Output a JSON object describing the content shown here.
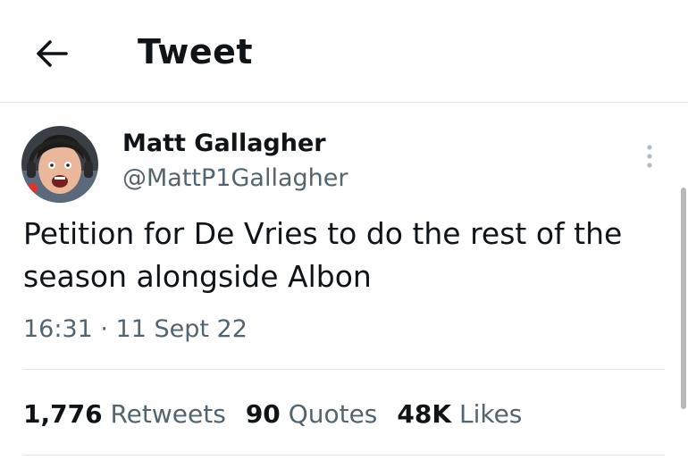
{
  "header": {
    "title": "Tweet",
    "back_icon": "arrow-left-icon"
  },
  "author": {
    "name": "Matt Gallagher",
    "handle": "@MattP1Gallagher"
  },
  "tweet": {
    "text_line1": "Petition for De Vries to do the rest of the",
    "text_line2": "season alongside Albon",
    "timestamp": "16:31 · 11 Sept 22"
  },
  "stats": [
    {
      "count": "1,776",
      "label": "Retweets"
    },
    {
      "count": "90",
      "label": "Quotes"
    },
    {
      "count": "48K",
      "label": "Likes"
    }
  ],
  "colors": {
    "text": "#0f1419",
    "secondary": "#536471",
    "divider": "#e1e6ea"
  }
}
